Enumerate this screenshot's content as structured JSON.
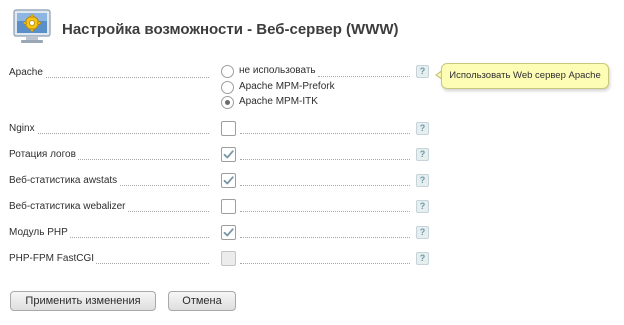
{
  "header": {
    "title": "Настройка возможности - Веб-сервер (WWW)",
    "icon": "settings-gear-monitor-icon",
    "accent_color": "#2f6fb0"
  },
  "rows": [
    {
      "label": "Apache",
      "type": "radio",
      "options": [
        "не использовать",
        "Apache MPM-Prefork",
        "Apache MPM-ITK"
      ],
      "selected": "Apache MPM-ITK",
      "help": "?"
    },
    {
      "label": "Nginx",
      "type": "checkbox",
      "checked": false,
      "help": "?"
    },
    {
      "label": "Ротация логов",
      "type": "checkbox",
      "checked": true,
      "help": "?"
    },
    {
      "label": "Веб-статистика awstats",
      "type": "checkbox",
      "checked": true,
      "help": "?"
    },
    {
      "label": "Веб-статистика webalizer",
      "type": "checkbox",
      "checked": false,
      "help": "?"
    },
    {
      "label": "Модуль PHP",
      "type": "checkbox",
      "checked": true,
      "help": "?"
    },
    {
      "label": "PHP-FPM FastCGI",
      "type": "checkbox",
      "checked": false,
      "disabled": true,
      "help": "?"
    }
  ],
  "tooltip": {
    "text": "Использовать Web сервер Apache",
    "background": "#fdfdb6"
  },
  "buttons": {
    "apply": "Применить изменения",
    "cancel": "Отмена"
  }
}
